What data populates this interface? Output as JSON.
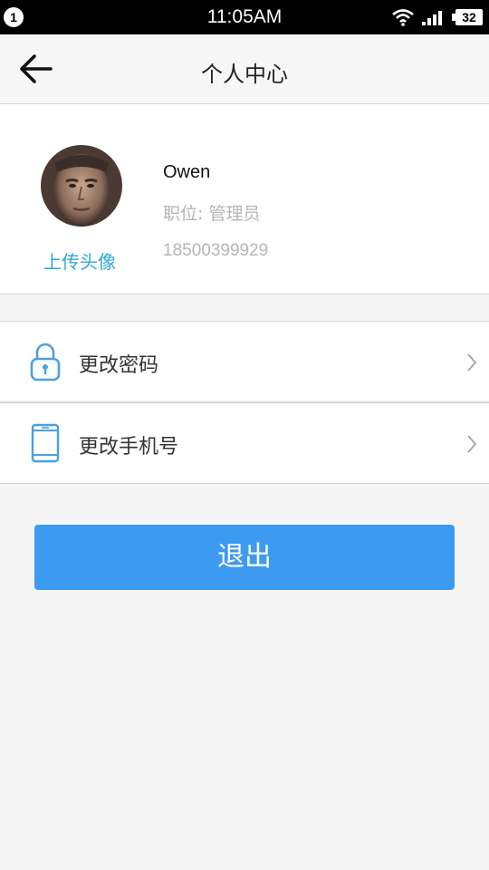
{
  "status_bar": {
    "notification_count": "1",
    "time": "11:05AM",
    "battery": "32",
    "icons": [
      "wifi-icon",
      "signal-icon",
      "battery-icon"
    ]
  },
  "header": {
    "title": "个人中心",
    "back_icon": "arrow-left-icon"
  },
  "profile": {
    "upload_avatar_label": "上传头像",
    "name": "Owen",
    "role": "职位: 管理员",
    "phone": "18500399929"
  },
  "menu": [
    {
      "label": "更改密码",
      "icon": "lock-icon"
    },
    {
      "label": "更改手机号",
      "icon": "phone-icon"
    }
  ],
  "logout_label": "退出",
  "colors": {
    "accent": "#3d9af1",
    "link": "#2ea8d6",
    "icon_blue": "#4a9fe3",
    "background": "#f5f5f5"
  }
}
